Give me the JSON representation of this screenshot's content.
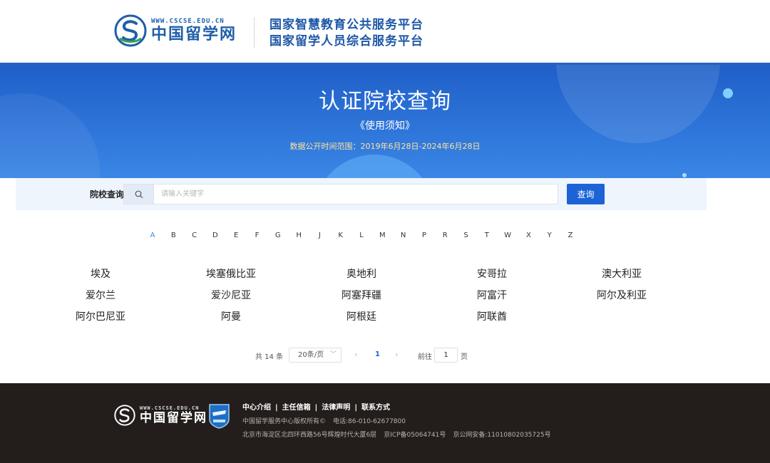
{
  "header": {
    "logo_url": "WWW.CSCSE.EDU.CN",
    "logo_name": "中国留学网",
    "platform_line1": "国家智慧教育公共服务平台",
    "platform_line2": "国家留学人员综合服务平台"
  },
  "banner": {
    "title": "认证院校查询",
    "notice": "《使用须知》",
    "date_range": "数据公开时间范围：2019年6月28日-2024年6月28日"
  },
  "search": {
    "label": "院校查询",
    "placeholder": "请输入关键字",
    "value": "",
    "button_label": "查询"
  },
  "alphabet": {
    "active": "A",
    "letters": [
      "A",
      "B",
      "C",
      "D",
      "E",
      "F",
      "G",
      "H",
      "J",
      "K",
      "L",
      "M",
      "N",
      "P",
      "R",
      "S",
      "T",
      "W",
      "X",
      "Y",
      "Z"
    ]
  },
  "countries": [
    "埃及",
    "埃塞俄比亚",
    "奥地利",
    "安哥拉",
    "澳大利亚",
    "爱尔兰",
    "爱沙尼亚",
    "阿塞拜疆",
    "阿富汗",
    "阿尔及利亚",
    "阿尔巴尼亚",
    "阿曼",
    "阿根廷",
    "阿联酋"
  ],
  "pagination": {
    "total_text": "共 14 条",
    "page_size": "20条/页",
    "current_page": "1",
    "goto_label": "前往",
    "goto_value": "1",
    "page_suffix": "页"
  },
  "footer": {
    "logo_url": "WWW.CSCSE.EDU.CN",
    "logo_name": "中国留学网",
    "links": [
      "中心介绍",
      "主任信箱",
      "法律声明",
      "联系方式"
    ],
    "copyright": "中国留学服务中心版权所有©",
    "phone": "电话:86-010-62677800",
    "address": "北京市海淀区北四环西路56号辉煌时代大厦6层",
    "icp": "京ICP备05064741号",
    "security": "京公网安备:11010802035725号"
  },
  "colors": {
    "brand_blue": "#1c64d6",
    "banner_top": "#1f5fc8",
    "banner_bottom": "#3a86e6",
    "active_letter": "#3a8ee6",
    "footer_bg": "#231e1c",
    "date_range": "#ffe39a"
  },
  "icons": {
    "search": "search-icon",
    "logo": "cscse-logo-icon",
    "badge": "service-badge-icon"
  }
}
